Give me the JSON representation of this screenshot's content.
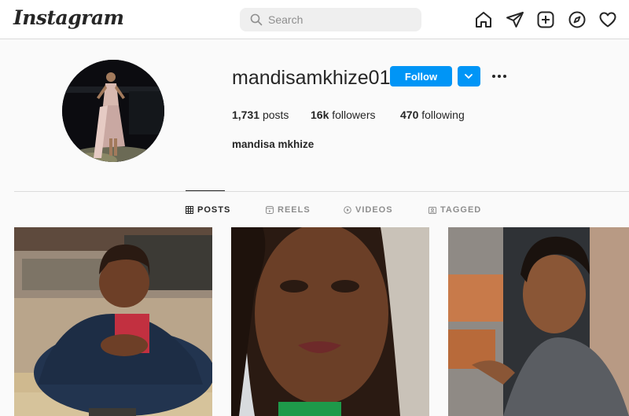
{
  "app": {
    "logo_text": "Instagram"
  },
  "search": {
    "placeholder": "Search"
  },
  "nav": {
    "icons": [
      "home-icon",
      "direct-send-icon",
      "new-post-icon",
      "explore-compass-icon",
      "activity-heart-icon"
    ]
  },
  "profile": {
    "username": "mandisamkhize01",
    "follow_label": "Follow",
    "posts_count": "1,731",
    "posts_label": "posts",
    "followers_count": "16k",
    "followers_label": "followers",
    "following_count": "470",
    "following_label": "following",
    "full_name": "mandisa mkhize"
  },
  "tabs": [
    {
      "label": "POSTS",
      "icon": "grid-icon",
      "active": true
    },
    {
      "label": "REELS",
      "icon": "reels-icon",
      "active": false
    },
    {
      "label": "VIDEOS",
      "icon": "video-play-icon",
      "active": false
    },
    {
      "label": "TAGGED",
      "icon": "tagged-icon",
      "active": false
    }
  ],
  "colors": {
    "accent": "#0095f6",
    "text": "#262626",
    "muted": "#8e8e8e",
    "border": "#dbdbdb",
    "background": "#fafafa"
  }
}
